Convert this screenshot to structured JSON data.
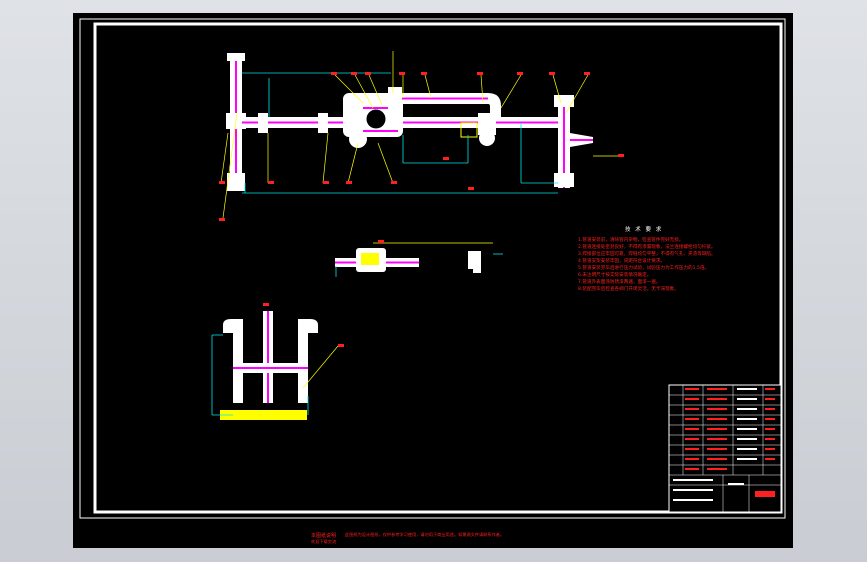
{
  "drawing": {
    "colors": {
      "background": "#000000",
      "frame": "#ffffff",
      "pipe": "#ffffff",
      "pipe_core": "#ff00ff",
      "dimension": "#00e6e6",
      "leader": "#ffff00",
      "text_red": "#ff2020",
      "hatch": "#ffff00"
    },
    "technical_requirements": {
      "title": "技 术 要 求",
      "items": [
        "1.管道安装前，清除管内杂物，检查管件完好无损。",
        "2.管道连接处密封良好，不得有渗漏现象，法兰连接螺栓均匀拧紧。",
        "3.焊接部位应牢固可靠，焊缝均匀平整，不得有气孔、夹渣等缺陷。",
        "4.管道支架安装牢固，间距符合设计要求。",
        "5.管道安装完毕后进行压力试验，试验压力为工作压力的1.5倍。",
        "6.未注明尺寸按实际安装情况确定。",
        "7.管道外表面涂防锈漆两遍，面漆一遍。",
        "8.装配完毕后检查各阀门开闭灵活，无卡滞现象。"
      ]
    },
    "footer": {
      "title": "本图纸说明",
      "body": "此图纸为设计图纸，仅供参考学习使用，请勿用于商业用途。如需源文件请联系作者。",
      "line2": "欢迎下载交流"
    }
  }
}
